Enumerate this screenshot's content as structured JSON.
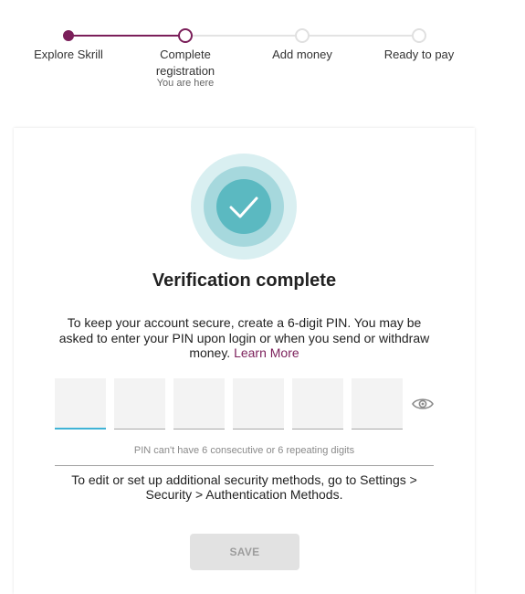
{
  "stepper": {
    "steps": [
      {
        "label": "Explore Skrill",
        "state": "done"
      },
      {
        "label": "Complete registration",
        "state": "current",
        "sublabel": "You are here"
      },
      {
        "label": "Add money",
        "state": "todo"
      },
      {
        "label": "Ready to pay",
        "state": "todo"
      }
    ]
  },
  "card": {
    "check_icon": "check-circle-icon",
    "title": "Verification complete",
    "info_text": "To keep your account secure, create a 6-digit PIN. You may be asked to enter your PIN upon login or when you send or withdraw money.",
    "learn_more_label": "Learn More",
    "pin": {
      "digits": [
        "",
        "",
        "",
        "",
        "",
        ""
      ],
      "active_index": 0,
      "toggle_icon": "eye-icon",
      "hint": "PIN can't have 6 consecutive or 6 repeating digits"
    },
    "security_note": "To edit or set up additional security methods, go to Settings > Security > Authentication Methods.",
    "save_label": "SAVE"
  },
  "colors": {
    "brand": "#7b1f5a",
    "track_todo": "#e3e3e3",
    "check_outer": "#d9eff1",
    "check_mid": "#a6d8dd",
    "check_core": "#5bb9c1",
    "pin_active": "#3fb3d6",
    "save_disabled_bg": "#e2e2e2",
    "save_disabled_text": "#9d9d9d"
  }
}
